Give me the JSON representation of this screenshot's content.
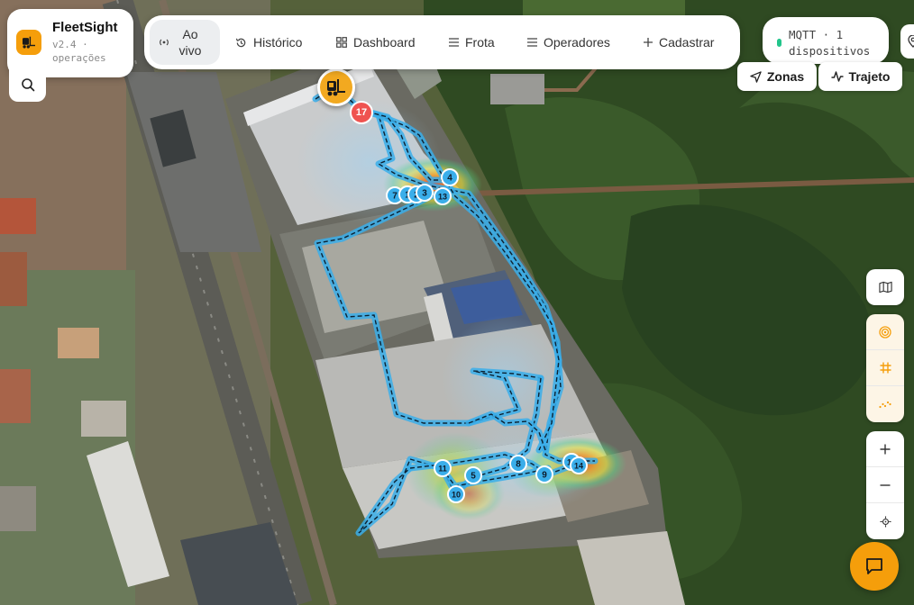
{
  "app": {
    "name": "FleetSight",
    "version_line": "v2.4 · operações"
  },
  "nav": {
    "items": [
      {
        "label": "Ao vivo",
        "icon": "live-broadcast-icon",
        "active": true
      },
      {
        "label": "Histórico",
        "icon": "history-icon",
        "active": false
      },
      {
        "label": "Dashboard",
        "icon": "dashboard-grid-icon",
        "active": false
      },
      {
        "label": "Frota",
        "icon": "list-icon",
        "active": false
      },
      {
        "label": "Operadores",
        "icon": "list-icon",
        "active": false
      },
      {
        "label": "Cadastrar",
        "icon": "plus-icon",
        "active": false
      }
    ]
  },
  "status": {
    "connection_text": "MQTT · 1 dispositivos",
    "connection_color": "#22c58b"
  },
  "map_controls": {
    "zones_label": "Zonas",
    "route_label": "Trajeto"
  },
  "vehicle": {
    "alert_count": "17",
    "marker_color": "#f2a920",
    "alert_color": "#ef5350"
  },
  "route": {
    "line_color": "#3aaeea",
    "point_color": "#3aaeea",
    "point_labels": [
      "7",
      "1",
      "2",
      "3",
      "4",
      "13",
      "11",
      "8",
      "5",
      "10",
      "9",
      "12",
      "14"
    ]
  },
  "colors": {
    "accent": "#f59e0b",
    "active_tab_bg": "#eceef0"
  }
}
